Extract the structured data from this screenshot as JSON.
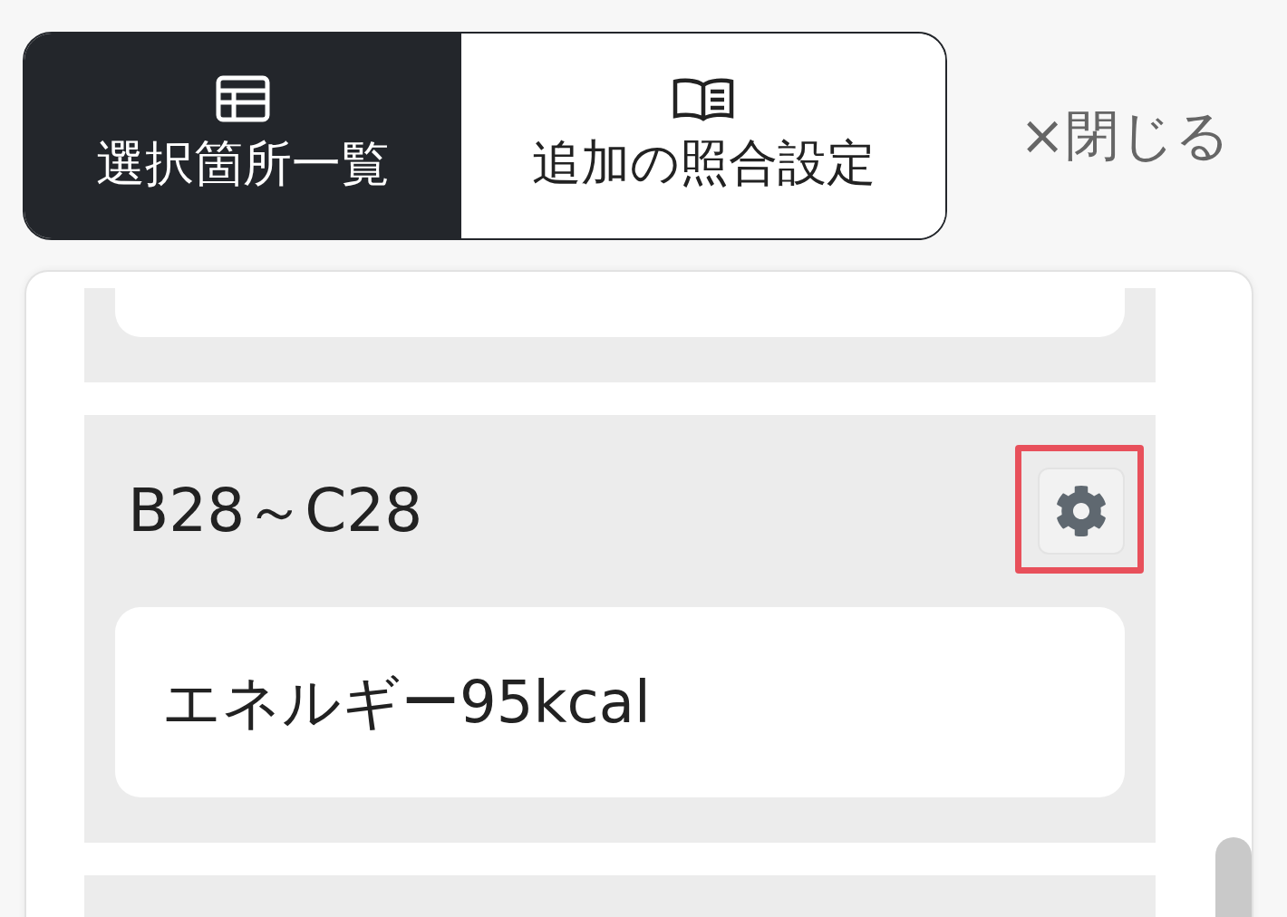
{
  "tabs": [
    {
      "label": "選択箇所一覧",
      "kind": "table",
      "selected": true
    },
    {
      "label": "追加の照合設定",
      "kind": "book",
      "selected": false
    }
  ],
  "close_button": {
    "label": "×閉じる"
  },
  "items": [
    {
      "range": "B28～C28",
      "value": "エネルギー95kcal",
      "highlighted": true
    }
  ]
}
